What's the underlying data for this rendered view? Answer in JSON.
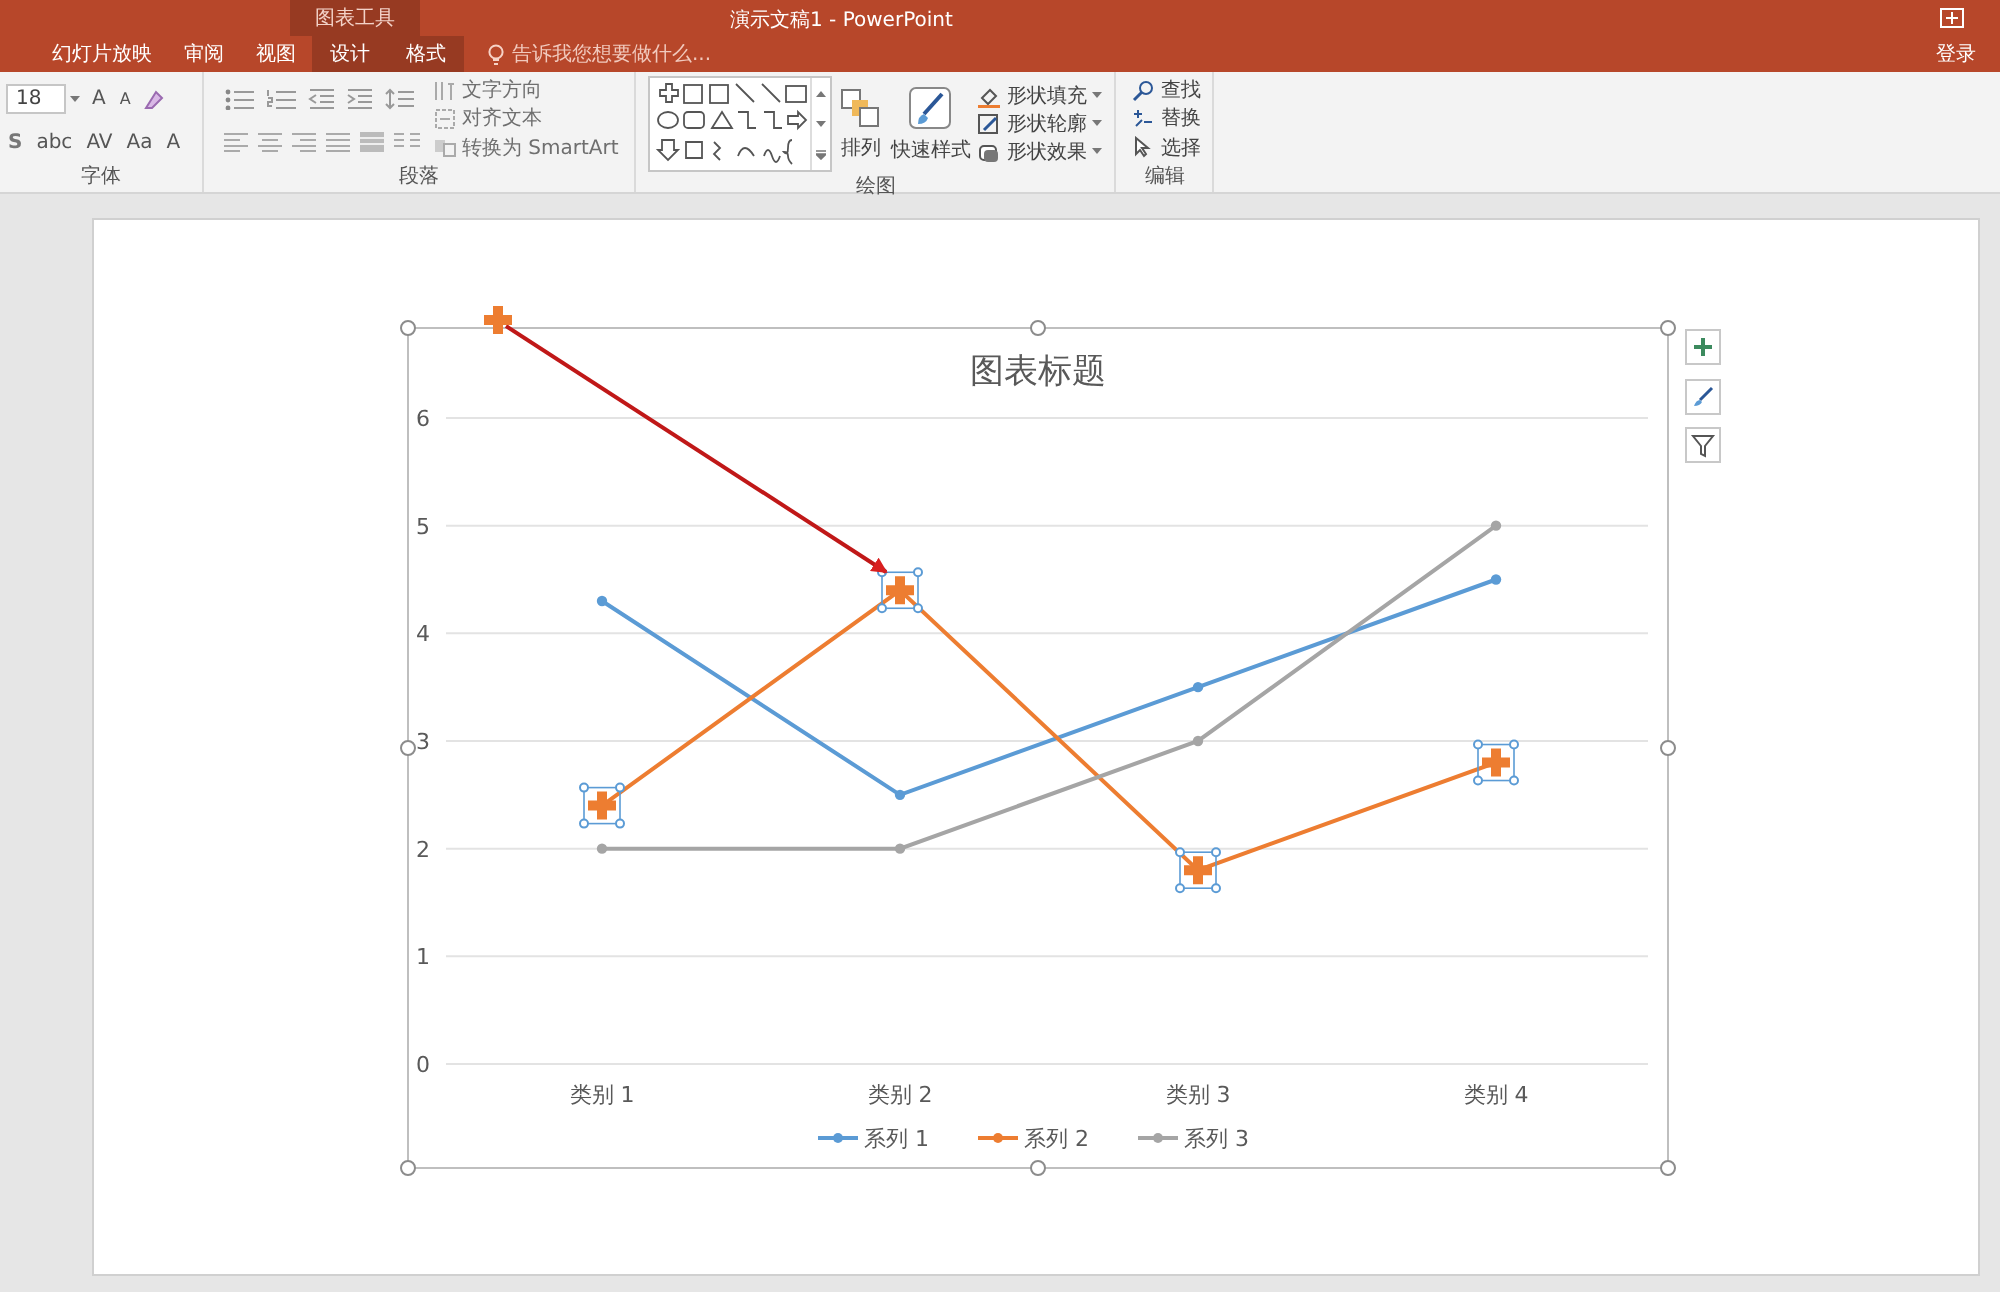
{
  "window": {
    "title": "演示文稿1 - PowerPoint",
    "context_group": "图表工具"
  },
  "tabs": [
    {
      "label": "幻灯片放映",
      "selected": false,
      "context": false
    },
    {
      "label": "审阅",
      "selected": false,
      "context": false
    },
    {
      "label": "视图",
      "selected": false,
      "context": false
    },
    {
      "label": "设计",
      "selected": false,
      "context": true
    },
    {
      "label": "格式",
      "selected": false,
      "context": true
    }
  ],
  "tell_me": {
    "placeholder": "告诉我您想要做什么..."
  },
  "sign_in": "登录",
  "ribbon": {
    "font_group": {
      "label": "字体",
      "size": "18",
      "row1_buttons": [
        "A",
        "A"
      ],
      "row2_buttons": [
        "S",
        "abc",
        "AV",
        "Aa",
        "A"
      ]
    },
    "paragraph_group": {
      "label": "段落",
      "commands": [
        "文字方向",
        "对齐文本",
        "转换为 SmartArt"
      ]
    },
    "drawing_group": {
      "label": "绘图",
      "arrange": "排列",
      "quick_styles": "快速样式",
      "commands": [
        "形状填充",
        "形状轮廓",
        "形状效果"
      ]
    },
    "editing_group": {
      "label": "编辑",
      "commands": [
        "查找",
        "替换",
        "选择"
      ]
    }
  },
  "chart": {
    "title": "图表标题",
    "series_state": [
      {
        "selected": false
      },
      {
        "selected": true
      },
      {
        "selected": false
      }
    ],
    "chart_data": {
      "type": "line",
      "categories": [
        "类别 1",
        "类别 2",
        "类别 3",
        "类别 4"
      ],
      "ylim": [
        0,
        6
      ],
      "yticks": [
        0,
        1,
        2,
        3,
        4,
        5,
        6
      ],
      "grid": true,
      "legend": "bottom",
      "series": [
        {
          "name": "系列 1",
          "color": "#5b9bd5",
          "marker": "circle",
          "values": [
            4.3,
            2.5,
            3.5,
            4.5
          ]
        },
        {
          "name": "系列 2",
          "color": "#ed7d31",
          "marker": "plus",
          "values": [
            2.4,
            4.4,
            1.8,
            2.8
          ]
        },
        {
          "name": "系列 3",
          "color": "#a5a5a5",
          "marker": "circle",
          "values": [
            2,
            2,
            3,
            5
          ]
        }
      ]
    }
  }
}
